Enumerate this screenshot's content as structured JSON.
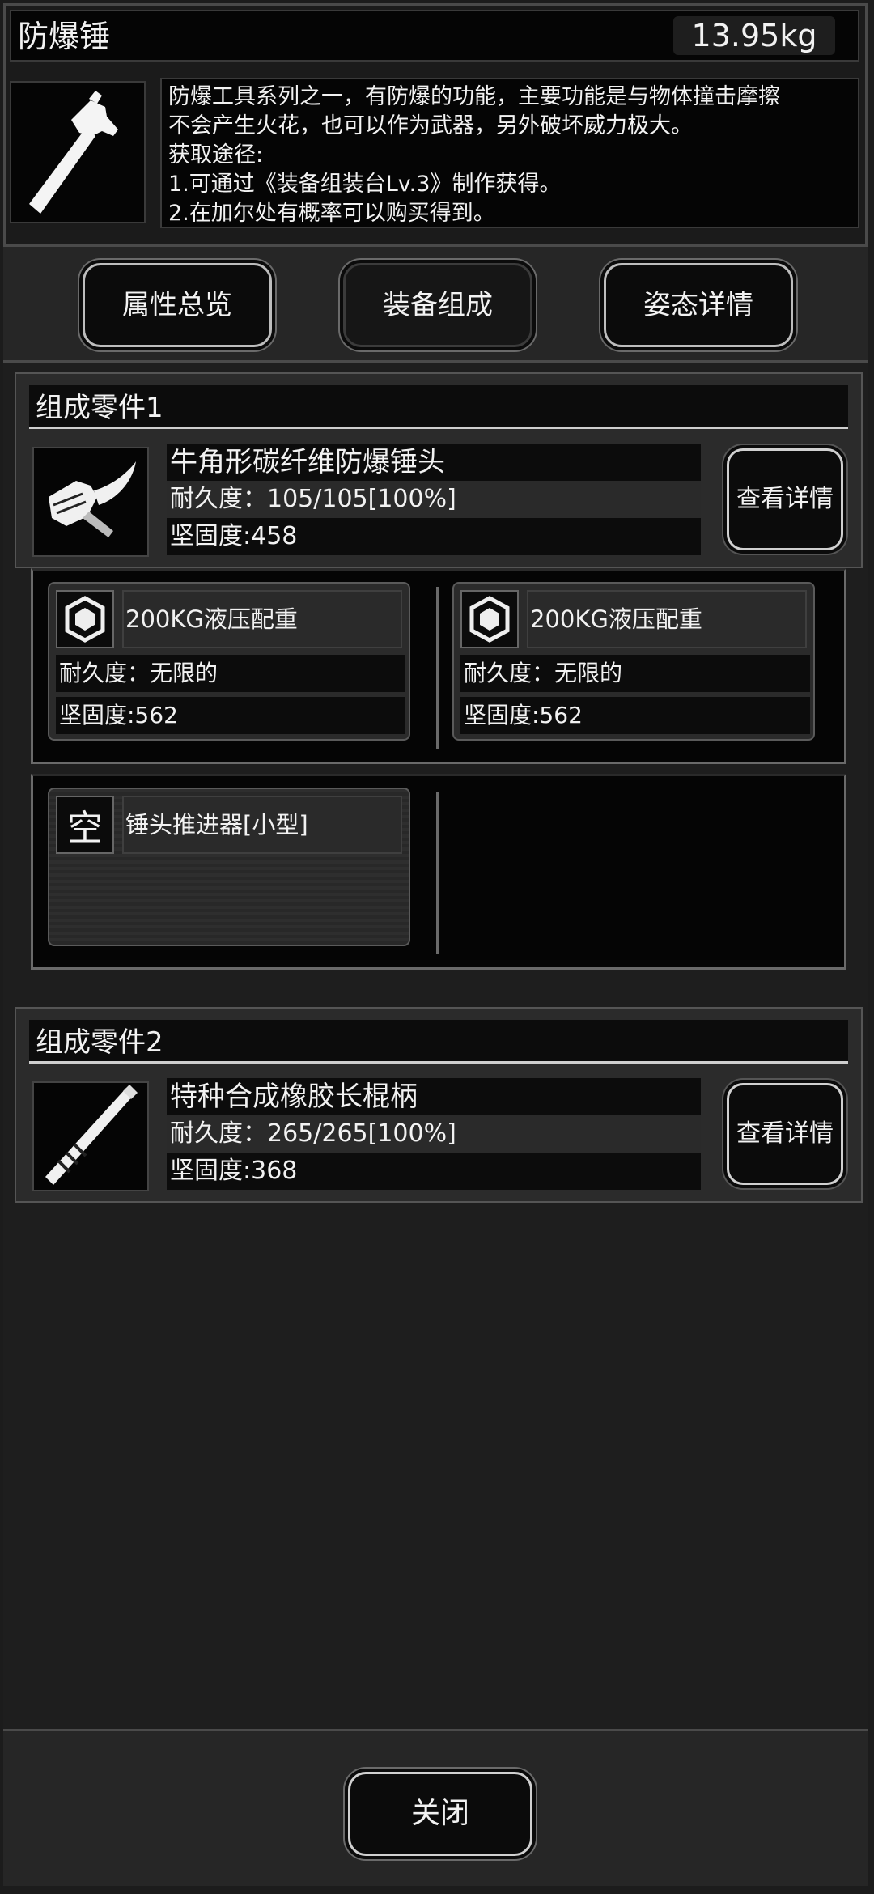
{
  "header": {
    "title": "防爆锤",
    "weight": "13.95kg"
  },
  "item": {
    "icon": "hammer-icon",
    "description_lines": [
      "防爆工具系列之一，有防爆的功能，主要功能是与物体撞击摩擦",
      "不会产生火花，也可以作为武器，另外破坏威力极大。",
      "获取途径:",
      "1.可通过《装备组装台Lv.3》制作获得。",
      "2.在加尔处有概率可以购买得到。"
    ]
  },
  "tabs": [
    {
      "label": "属性总览",
      "active": false
    },
    {
      "label": "装备组成",
      "active": true
    },
    {
      "label": "姿态详情",
      "active": false
    }
  ],
  "components": [
    {
      "header": "组成零件1",
      "icon": "hammer-head-icon",
      "name": "牛角形碳纤维防爆锤头",
      "durability": "耐久度：105/105[100%]",
      "hardness": "坚固度:458",
      "detail_label": "查看详情",
      "slots_row1": [
        {
          "icon": "weight-icon",
          "name": "200KG液压配重",
          "durability": "耐久度：无限的",
          "hardness": "坚固度:562"
        },
        {
          "icon": "weight-icon",
          "name": "200KG液压配重",
          "durability": "耐久度：无限的",
          "hardness": "坚固度:562"
        }
      ],
      "slots_row2": [
        {
          "icon_text": "空",
          "name": "锤头推进器[小型]"
        }
      ]
    },
    {
      "header": "组成零件2",
      "icon": "handle-icon",
      "name": "特种合成橡胶长棍柄",
      "durability": "耐久度：265/265[100%]",
      "hardness": "坚固度:368",
      "detail_label": "查看详情"
    }
  ],
  "footer": {
    "close_label": "关闭"
  }
}
